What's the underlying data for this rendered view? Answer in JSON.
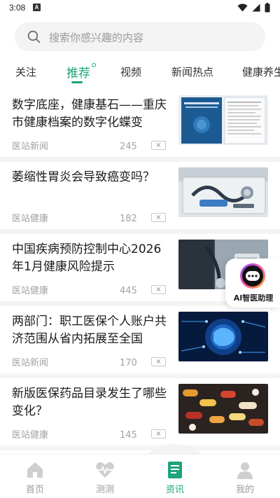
{
  "status_bar": {
    "time": "3:08",
    "notification_letter": "A",
    "icons": [
      "wifi-icon",
      "signal-icon",
      "battery-icon"
    ]
  },
  "search": {
    "placeholder": "搜索你感兴趣的内容",
    "icon": "search-icon"
  },
  "tabs": [
    {
      "label": "关注",
      "active": false
    },
    {
      "label": "推荐",
      "active": true
    },
    {
      "label": "视频",
      "active": false
    },
    {
      "label": "新闻热点",
      "active": false
    },
    {
      "label": "健康养生",
      "active": false
    }
  ],
  "feed": [
    {
      "title": "数字底座，健康基石——重庆市健康档案的数字化蝶变",
      "source": "医站新闻",
      "count": "245",
      "close": "×",
      "thumb": "document-cover-image"
    },
    {
      "title": "萎缩性胃炎会导致癌变吗？",
      "source": "医站健康",
      "count": "182",
      "close": "×",
      "thumb": "medical-equipment-image"
    },
    {
      "title": "中国疾病预防控制中心2026年1月健康风险提示",
      "source": "医站健康",
      "count": "445",
      "close": "×",
      "thumb": "doctor-stethoscope-image"
    },
    {
      "title": "两部门：职工医保个人账户共济范围从省内拓展至全国",
      "source": "医站新闻",
      "count": "170",
      "close": "×",
      "thumb": "digital-brain-image"
    },
    {
      "title": "新版医保药品目录发生了哪些变化？",
      "source": "医站健康",
      "count": "145",
      "close": "×",
      "thumb": "medicine-pills-image"
    }
  ],
  "ai_assistant": {
    "label": "AI智医助理",
    "icon": "chat-bot-icon"
  },
  "bottom_nav": [
    {
      "label": "首页",
      "icon": "home-icon",
      "active": false
    },
    {
      "label": "测测",
      "icon": "heart-pulse-icon",
      "active": false
    },
    {
      "label": "资讯",
      "icon": "news-icon",
      "active": true
    },
    {
      "label": "我的",
      "icon": "profile-icon",
      "active": false
    }
  ],
  "colors": {
    "accent": "#1ea37c",
    "muted_text": "#a3a3a3",
    "separator": "#f4f4f4",
    "search_bg": "#f3f3f3"
  }
}
